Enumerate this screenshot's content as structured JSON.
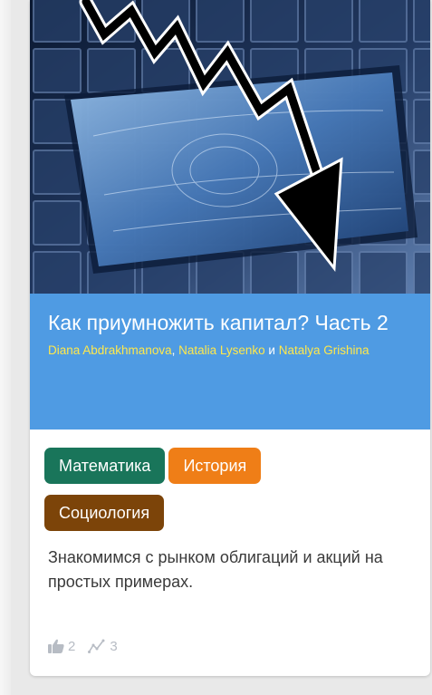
{
  "card": {
    "title": "Как приумножить капитал? Часть 2",
    "authors": [
      "Diana Abdrakhmanova",
      "Natalia Lysenko",
      "Natalya Grishina"
    ],
    "authors_separator": ", ",
    "authors_conjunction": " и ",
    "tags": [
      {
        "label": "Математика",
        "color": "#19755a"
      },
      {
        "label": "История",
        "color": "#ef7e17"
      },
      {
        "label": "Социология",
        "color": "#7c4409"
      }
    ],
    "description": "Знакомимся с рынком облигаций и акций на простых примерах.",
    "stats": {
      "likes": "2",
      "views": "3"
    },
    "colors": {
      "header": "#4f9be3",
      "author_link": "#ffe84b"
    }
  },
  "icons": {
    "like": "thumbs-up-icon",
    "views": "trend-icon"
  }
}
